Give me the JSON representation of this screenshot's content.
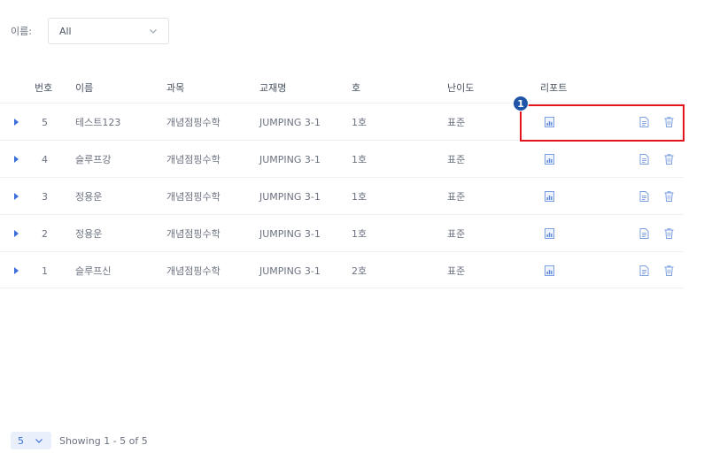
{
  "filter": {
    "label": "이름:",
    "selected": "All"
  },
  "table": {
    "headers": {
      "num": "번호",
      "name": "이름",
      "course": "과목",
      "book": "교재명",
      "ho": "호",
      "difficulty": "난이도",
      "report": "리포트"
    },
    "rows": [
      {
        "num": "5",
        "name": "테스트123",
        "course": "개념점핑수학",
        "book": "JUMPING 3-1",
        "ho": "1호",
        "difficulty": "표준"
      },
      {
        "num": "4",
        "name": "슬루프강",
        "course": "개념점핑수학",
        "book": "JUMPING 3-1",
        "ho": "1호",
        "difficulty": "표준"
      },
      {
        "num": "3",
        "name": "정용운",
        "course": "개념점핑수학",
        "book": "JUMPING 3-1",
        "ho": "1호",
        "difficulty": "표준"
      },
      {
        "num": "2",
        "name": "정용운",
        "course": "개념점핑수학",
        "book": "JUMPING 3-1",
        "ho": "1호",
        "difficulty": "표준"
      },
      {
        "num": "1",
        "name": "슬루프신",
        "course": "개념점핑수학",
        "book": "JUMPING 3-1",
        "ho": "2호",
        "difficulty": "표준"
      }
    ]
  },
  "annotation": {
    "badge": "1",
    "color": "#e3141b"
  },
  "pager": {
    "page_size": "5",
    "summary": "Showing 1 - 5 of 5"
  },
  "colors": {
    "accent": "#3b6fd8",
    "badge": "#1f54a6"
  },
  "icons": {
    "expand": "caret-right-icon",
    "report": "chart-report-icon",
    "document": "document-icon",
    "delete": "trash-icon"
  }
}
